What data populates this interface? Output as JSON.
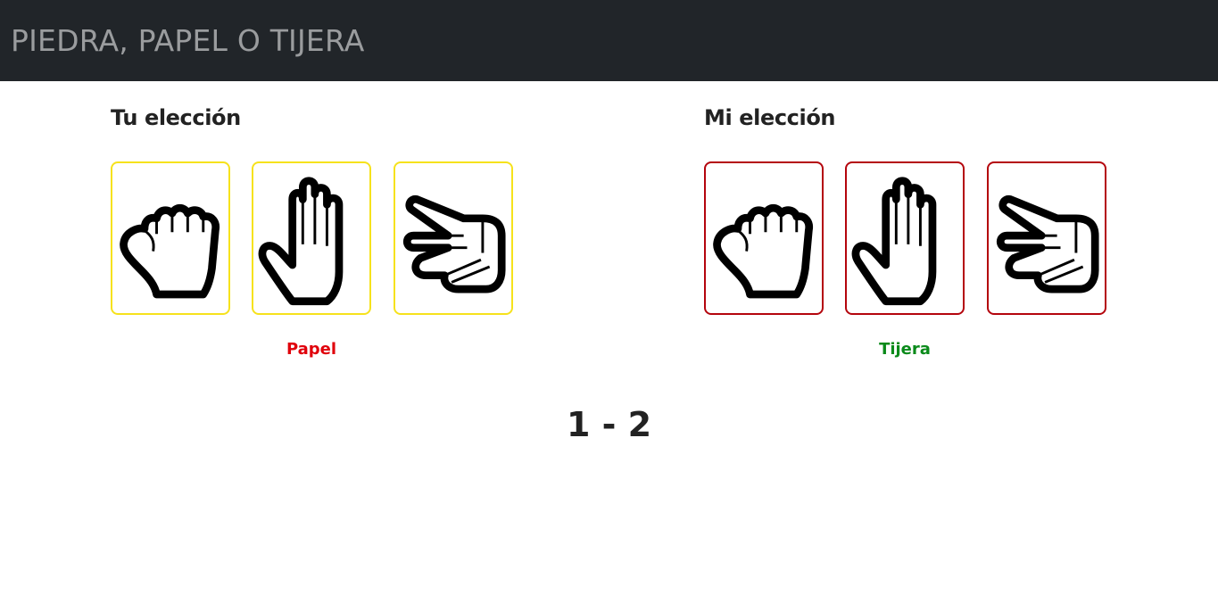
{
  "app": {
    "title": "PIEDRA, PAPEL O TIJERA"
  },
  "player": {
    "heading": "Tu elección",
    "options": [
      {
        "name": "Piedra",
        "icon": "rock-hand-icon"
      },
      {
        "name": "Papel",
        "icon": "paper-hand-icon"
      },
      {
        "name": "Tijera",
        "icon": "scissors-hand-icon"
      }
    ],
    "selected": "Papel",
    "border_color": "#f6e21c",
    "result_color": "#e0000b"
  },
  "cpu": {
    "heading": "Mi elección",
    "options": [
      {
        "name": "Piedra",
        "icon": "rock-hand-icon"
      },
      {
        "name": "Papel",
        "icon": "paper-hand-icon"
      },
      {
        "name": "Tijera",
        "icon": "scissors-hand-icon"
      }
    ],
    "selected": "Tijera",
    "border_color": "#b4050d",
    "result_color": "#0a8a1a"
  },
  "score": {
    "text": "1 - 2"
  }
}
